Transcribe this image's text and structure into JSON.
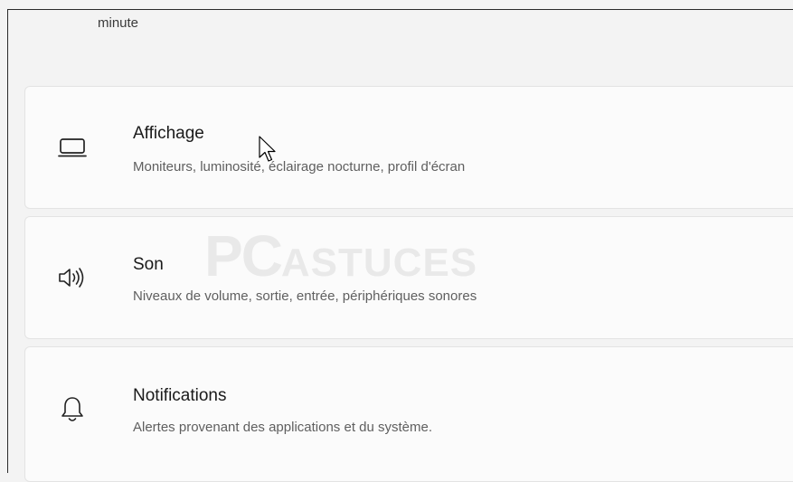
{
  "top_text": "minute",
  "cards": [
    {
      "title": "Affichage",
      "subtitle": "Moniteurs, luminosité, éclairage nocturne, profil d'écran",
      "icon": "monitor-icon"
    },
    {
      "title": "Son",
      "subtitle": "Niveaux de volume, sortie, entrée, périphériques sonores",
      "icon": "speaker-icon"
    },
    {
      "title": "Notifications",
      "subtitle": "Alertes provenant des applications et du système.",
      "icon": "bell-icon"
    }
  ],
  "watermark": {
    "pc": "PC",
    "astuces": "ASTUCES"
  }
}
